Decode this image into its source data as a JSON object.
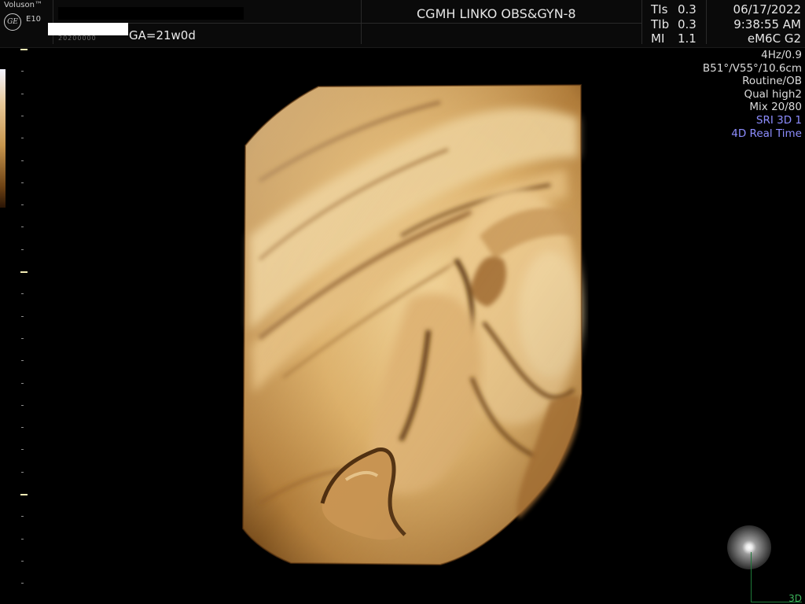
{
  "header": {
    "brand": "Voluson™",
    "logo": "GE",
    "model": "E10",
    "patient_id_partial": "20200000",
    "ga": "GA=21w0d",
    "site": "CGMH LINKO OBS&GYN-8",
    "acoustic": [
      {
        "label": "TIs",
        "value": "0.3"
      },
      {
        "label": "TIb",
        "value": "0.3"
      },
      {
        "label": "MI",
        "value": "1.1"
      }
    ],
    "date": "06/17/2022",
    "time": "9:38:55 AM",
    "probe": "eM6C G2"
  },
  "params": {
    "rate": "4Hz/0.9",
    "angles": "B51°/V55°/10.6cm",
    "preset": "Routine/OB",
    "quality": "Qual high2",
    "mix": "Mix 20/80",
    "sri": "SRI 3D 1",
    "mode": "4D Real Time"
  },
  "corner_label": "3D",
  "colors": {
    "background": "#000000",
    "render_light": "#e3bd7c",
    "render_dark": "#6b4316",
    "mode_text": "#8d8dff",
    "corner_green": "#3cb35a",
    "major_tick": "#f2ebb4"
  },
  "icons": [
    "ge-logo-icon",
    "orientation-ball-icon"
  ]
}
